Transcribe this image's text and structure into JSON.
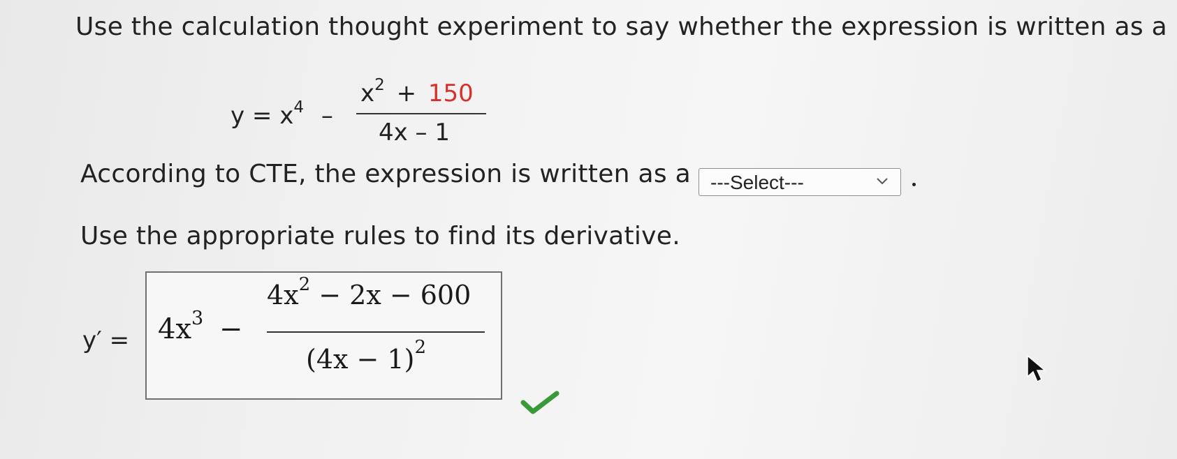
{
  "question": {
    "prompt": "Use the calculation thought experiment to say whether the expression is written as a",
    "equation": {
      "lhs": "y = x",
      "exp1": "4",
      "minus": "–",
      "num_x": "x",
      "num_exp": "2",
      "num_plus": "+",
      "num_const": "150",
      "denominator": "4x – 1"
    },
    "cte_sentence": "According to CTE, the expression is written as a",
    "select_value": "---Select---",
    "period": ".",
    "rules_sentence": "Use the appropriate rules to find its derivative."
  },
  "answer": {
    "label": "y′ =",
    "term_base": "4x",
    "term_exp": "3",
    "minus": "−",
    "numerator": "4x",
    "numerator_exp": "2",
    "numerator_rest": " − 2x − 600",
    "denominator": "(4x − 1)",
    "denominator_exp": "2",
    "status": "correct"
  },
  "colors": {
    "highlight_red": "#d6302c",
    "check_green": "#3a9a3a"
  }
}
